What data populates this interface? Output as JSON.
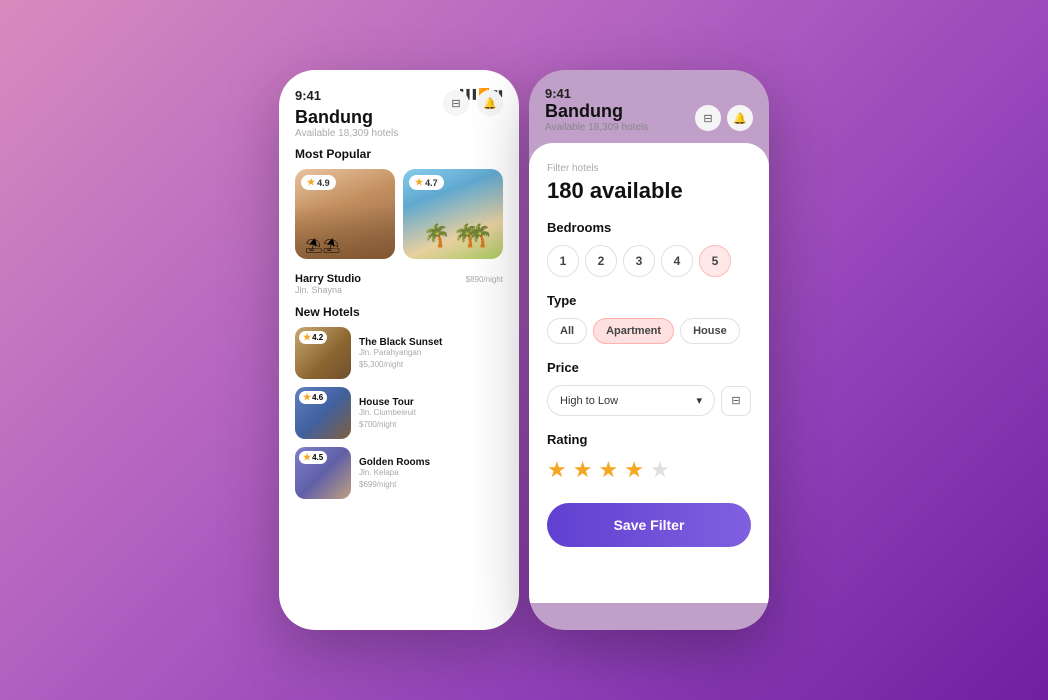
{
  "phone1": {
    "time": "9:41",
    "city": "Bandung",
    "available": "Available 18,309 hotels",
    "status_icons": [
      "signal",
      "wifi",
      "battery"
    ],
    "most_popular_label": "Most Popular",
    "featured_hotel": {
      "name": "Harry Studio",
      "street": "Jln. Shayna",
      "price": "$890",
      "price_unit": "/night",
      "rating1": "4.9",
      "rating2": "4.7"
    },
    "new_hotels_label": "New Hotels",
    "hotels": [
      {
        "name": "The Black Sunset",
        "street": "Jln. Parahyangan",
        "price": "$5,300",
        "price_unit": "/night",
        "rating": "4.2"
      },
      {
        "name": "House Tour",
        "street": "Jln. Ciumbeleuit",
        "price": "$700",
        "price_unit": "/night",
        "rating": "4.6"
      },
      {
        "name": "Golden Rooms",
        "street": "Jln. Kelapa",
        "price": "$699",
        "price_unit": "/night",
        "rating": "4.5"
      }
    ]
  },
  "phone2": {
    "time": "9:41",
    "city": "Bandung",
    "available": "Available 18,309 hotels",
    "filter_label": "Filter hotels",
    "count": "180 available",
    "bedrooms_label": "Bedrooms",
    "bedrooms": [
      "1",
      "2",
      "3",
      "4",
      "5"
    ],
    "active_bedroom": "5",
    "type_label": "Type",
    "types": [
      "All",
      "Apartment",
      "House"
    ],
    "active_type": "Apartment",
    "price_label": "Price",
    "price_selected": "High to Low",
    "rating_label": "Rating",
    "rating_filled": 4,
    "rating_empty": 1,
    "save_button": "Save Filter"
  }
}
